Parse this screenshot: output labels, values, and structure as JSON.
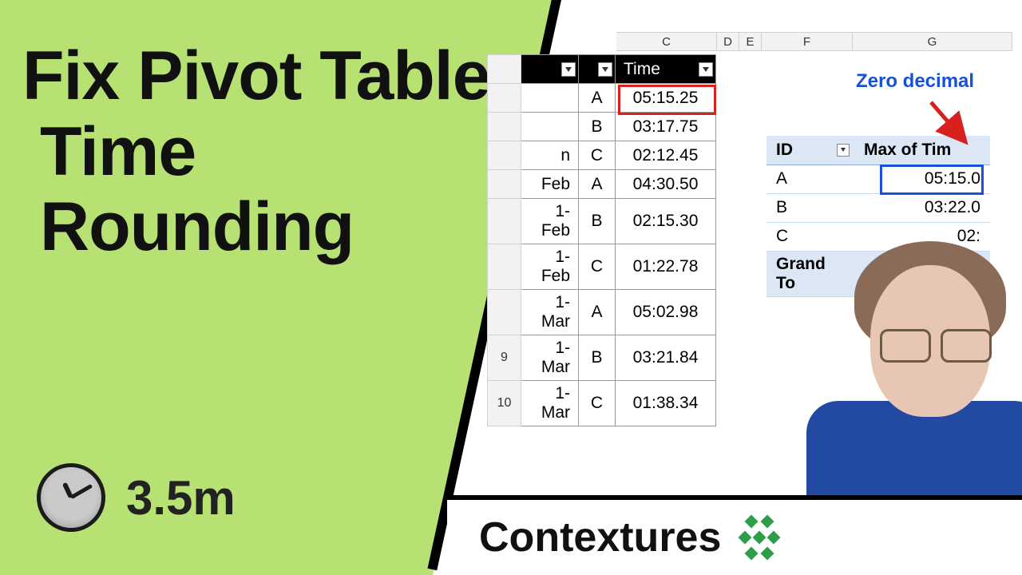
{
  "title": {
    "line1": "Fix Pivot Table",
    "line2": "Time",
    "line3": "Rounding"
  },
  "duration": "3.5m",
  "brand": "Contextures",
  "annotation": "Zero decimal",
  "columns": {
    "C": "C",
    "D": "D",
    "E": "E",
    "F": "F",
    "G": "G"
  },
  "data_table": {
    "headers": {
      "id_partial": "",
      "time": "Time"
    },
    "rows": [
      {
        "rn": "",
        "month": "",
        "id": "A",
        "time": "05:15.25"
      },
      {
        "rn": "",
        "month": "",
        "id": "B",
        "time": "03:17.75"
      },
      {
        "rn": "",
        "month": "n",
        "id": "C",
        "time": "02:12.45"
      },
      {
        "rn": "",
        "month": "Feb",
        "id": "A",
        "time": "04:30.50"
      },
      {
        "rn": "",
        "month": "1-Feb",
        "id": "B",
        "time": "02:15.30"
      },
      {
        "rn": "",
        "month": "1-Feb",
        "id": "C",
        "time": "01:22.78"
      },
      {
        "rn": "",
        "month": "1-Mar",
        "id": "A",
        "time": "05:02.98"
      },
      {
        "rn": "9",
        "month": "1-Mar",
        "id": "B",
        "time": "03:21.84"
      },
      {
        "rn": "10",
        "month": "1-Mar",
        "id": "C",
        "time": "01:38.34"
      }
    ]
  },
  "pivot": {
    "headers": {
      "id": "ID",
      "max": "Max of Tim"
    },
    "rows": [
      {
        "id": "A",
        "val": "05:15.0"
      },
      {
        "id": "B",
        "val": "03:22.0"
      },
      {
        "id": "C",
        "val": "02:"
      }
    ],
    "grand_label": "Grand To",
    "grand_val": ""
  },
  "colors": {
    "accent_green": "#b8e173",
    "highlight_red": "#d8201f",
    "highlight_blue": "#1751d4"
  }
}
